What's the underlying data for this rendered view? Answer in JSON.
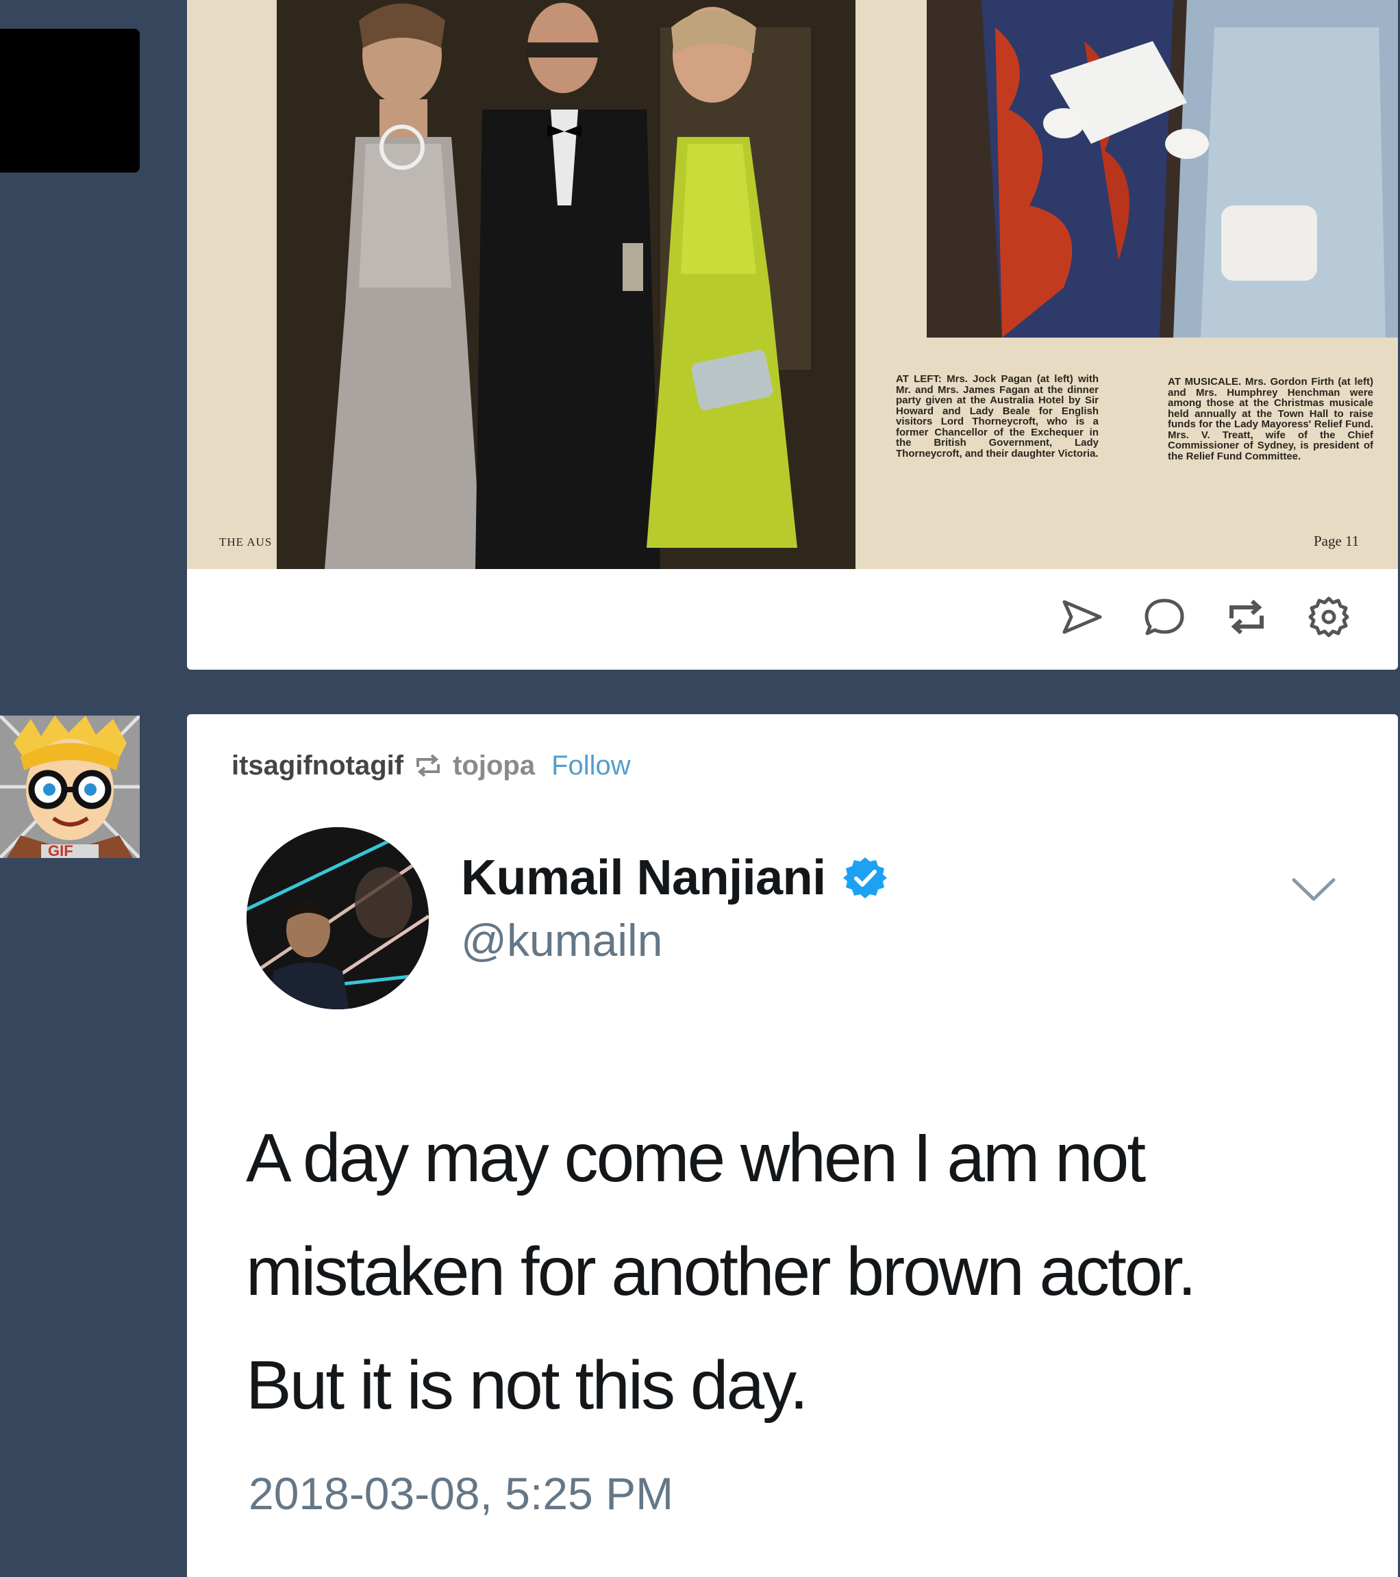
{
  "post1": {
    "caption_left": "AT LEFT: Mrs. Jock Pagan (at left) with Mr. and Mrs. James Fagan at the dinner party given at the Australia Hotel by Sir Howard and Lady Beale for English visitors Lord Thorneycroft, who is a former Chancellor of the Exchequer in the British Government, Lady Thorneycroft, and their daughter Victoria.",
    "caption_right": "AT MUSICALE. Mrs. Gordon Firth (at left) and Mrs. Humphrey Henchman were among those at the Christmas musicale held annually at the Town Hall to raise funds for the Lady Mayoress' Relief Fund. Mrs. V. Treatt, wife of the Chief Commissioner of Sydney, is president of the Relief Fund Committee.",
    "footer": "THE AUS",
    "page_number": "Page 11",
    "actions": [
      "send-icon",
      "comment-icon",
      "reblog-icon",
      "settings-icon"
    ]
  },
  "post2": {
    "author": "itsagifnotagif",
    "source": "tojopa",
    "follow_label": "Follow",
    "avatar_badge": "GIF",
    "tweet": {
      "name": "Kumail Nanjiani",
      "handle": "@kumailn",
      "lines": [
        "A day may come when I am not",
        "mistaken for another brown actor.",
        "But it is not this day."
      ],
      "timestamp": "2018-03-08, 5:25 PM"
    }
  },
  "colors": {
    "dashboard_bg": "#36465d",
    "follow": "#529ecc",
    "verified": "#1da1f2"
  }
}
